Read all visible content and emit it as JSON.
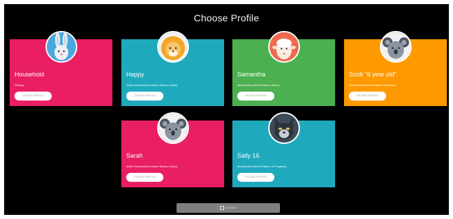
{
  "page": {
    "title": "Choose Profile"
  },
  "colors": {
    "pink": "#e91e63",
    "teal": "#1fa9bd",
    "green": "#4caf50",
    "orange": "#ff9900",
    "background": "#000000"
  },
  "profiles": [
    {
      "name": "Household",
      "status": "Primary",
      "button": "CHOOSE PROFILE",
      "avatar": "rabbit-icon",
      "color": "pink"
    },
    {
      "name": "Happy",
      "status": "Adult Volunteer(Enrollment Status: Active)",
      "button": "CHOOSE PROFILE",
      "avatar": "lion-icon",
      "color": "teal"
    },
    {
      "name": "Samantha",
      "status": "Member(Enrollment Status: Active)",
      "button": "CHOOSE PROFILE",
      "avatar": "sheep-icon",
      "color": "green"
    },
    {
      "name": "Scott \"6 year old\"",
      "status": "Member(Enrollment Status: Returned)",
      "button": "CHOOSE PROFILE",
      "avatar": "koala-icon",
      "color": "orange"
    },
    {
      "name": "Sarah",
      "status": "Adult Volunteer(Enrollment Status: Active)",
      "button": "CHOOSE PROFILE",
      "avatar": "koala-icon",
      "color": "pink"
    },
    {
      "name": "Sally 16",
      "status": "Member(Enrollment Status: In Progress)",
      "button": "CHOOSE PROFILE",
      "avatar": "wolf-icon",
      "color": "teal"
    }
  ],
  "logout": {
    "label": "LOGOUT",
    "icon": "logout-icon"
  }
}
